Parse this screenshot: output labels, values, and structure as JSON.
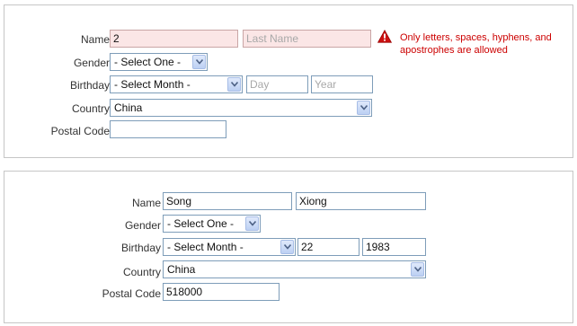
{
  "form_invalid": {
    "name_label": "Name",
    "first_name": {
      "value": "2",
      "placeholder": ""
    },
    "last_name": {
      "value": "",
      "placeholder": "Last Name"
    },
    "error_message": "Only letters, spaces, hyphens, and apostrophes are allowed",
    "gender_label": "Gender",
    "gender_selected": "- Select One -",
    "birthday_label": "Birthday",
    "month_selected": "- Select Month -",
    "day": {
      "value": "",
      "placeholder": "Day"
    },
    "year": {
      "value": "",
      "placeholder": "Year"
    },
    "country_label": "Country",
    "country_selected": "China",
    "postal_label": "Postal Code",
    "postal": {
      "value": "",
      "placeholder": ""
    }
  },
  "form_filled": {
    "name_label": "Name",
    "first_name": {
      "value": "Song",
      "placeholder": ""
    },
    "last_name": {
      "value": "Xiong",
      "placeholder": ""
    },
    "gender_label": "Gender",
    "gender_selected": "- Select One -",
    "birthday_label": "Birthday",
    "month_selected": "- Select Month -",
    "day": {
      "value": "22",
      "placeholder": ""
    },
    "year": {
      "value": "1983",
      "placeholder": ""
    },
    "country_label": "Country",
    "country_selected": "China",
    "postal_label": "Postal Code",
    "postal": {
      "value": "518000",
      "placeholder": ""
    }
  },
  "icons": {
    "dropdown_arrow": "chevron-down-icon",
    "error": "warning-triangle-icon"
  },
  "colors": {
    "error_text": "#cc0000",
    "error_field_bg": "#fbe6e6",
    "input_border": "#7e9db9"
  }
}
